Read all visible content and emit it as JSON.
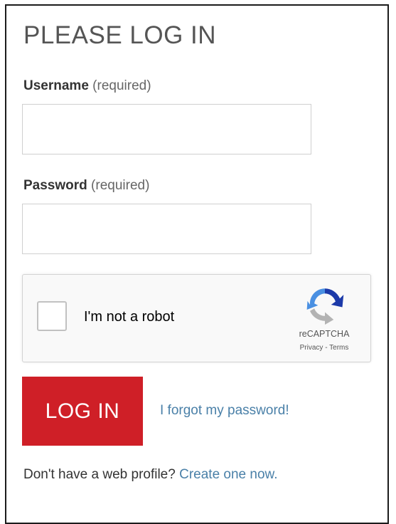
{
  "form": {
    "title": "PLEASE LOG IN",
    "username": {
      "label": "Username",
      "required_text": "(required)",
      "value": "",
      "placeholder": ""
    },
    "password": {
      "label": "Password",
      "required_text": "(required)",
      "value": "",
      "placeholder": ""
    }
  },
  "captcha": {
    "checkbox_label": "I'm not a robot",
    "checked": false,
    "brand": "reCAPTCHA",
    "privacy_link": "Privacy",
    "separator": " - ",
    "terms_link": "Terms",
    "logo_icon": "recaptcha-logo-icon",
    "colors": {
      "blue": "#1c3aa9",
      "light_blue": "#4a90e2",
      "gray": "#b3b3b3"
    }
  },
  "actions": {
    "login_label": "LOG IN",
    "forgot_password": "I forgot my password!"
  },
  "signup": {
    "prompt": "Don't have a web profile?",
    "link": "Create one now."
  },
  "colors": {
    "accent": "#cf1f27",
    "link": "#4a80a8",
    "border": "#1b1b1b"
  }
}
